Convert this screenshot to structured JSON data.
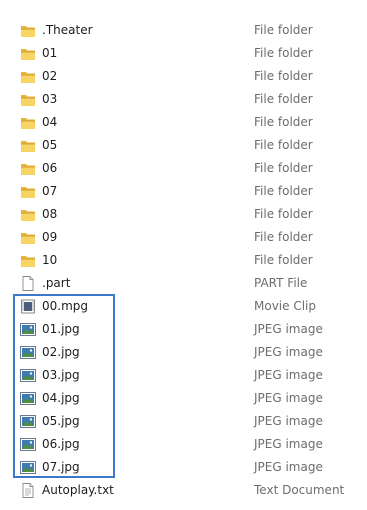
{
  "rows": [
    {
      "name": ".Theater",
      "type": "File folder",
      "icon": "folder-icon"
    },
    {
      "name": "01",
      "type": "File folder",
      "icon": "folder-icon"
    },
    {
      "name": "02",
      "type": "File folder",
      "icon": "folder-icon"
    },
    {
      "name": "03",
      "type": "File folder",
      "icon": "folder-icon"
    },
    {
      "name": "04",
      "type": "File folder",
      "icon": "folder-icon"
    },
    {
      "name": "05",
      "type": "File folder",
      "icon": "folder-icon"
    },
    {
      "name": "06",
      "type": "File folder",
      "icon": "folder-icon"
    },
    {
      "name": "07",
      "type": "File folder",
      "icon": "folder-icon"
    },
    {
      "name": "08",
      "type": "File folder",
      "icon": "folder-icon"
    },
    {
      "name": "09",
      "type": "File folder",
      "icon": "folder-icon"
    },
    {
      "name": "10",
      "type": "File folder",
      "icon": "folder-icon"
    },
    {
      "name": ".part",
      "type": "PART File",
      "icon": "blank-file-icon"
    },
    {
      "name": "00.mpg",
      "type": "Movie Clip",
      "icon": "video-file-icon"
    },
    {
      "name": "01.jpg",
      "type": "JPEG image",
      "icon": "image-file-icon"
    },
    {
      "name": "02.jpg",
      "type": "JPEG image",
      "icon": "image-file-icon"
    },
    {
      "name": "03.jpg",
      "type": "JPEG image",
      "icon": "image-file-icon"
    },
    {
      "name": "04.jpg",
      "type": "JPEG image",
      "icon": "image-file-icon"
    },
    {
      "name": "05.jpg",
      "type": "JPEG image",
      "icon": "image-file-icon"
    },
    {
      "name": "06.jpg",
      "type": "JPEG image",
      "icon": "image-file-icon"
    },
    {
      "name": "07.jpg",
      "type": "JPEG image",
      "icon": "image-file-icon"
    },
    {
      "name": "Autoplay.txt",
      "type": "Text Document",
      "icon": "text-file-icon"
    }
  ],
  "colors": {
    "selection_outline": "#3a78c9",
    "type_text": "#6d6d6d",
    "name_text": "#1e1e1e"
  }
}
